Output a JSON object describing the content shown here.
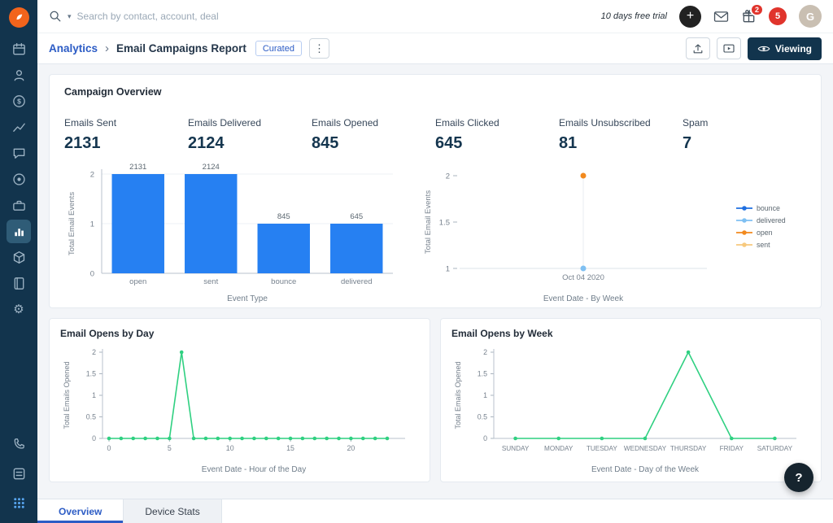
{
  "topbar": {
    "search_placeholder": "Search by contact, account, deal",
    "trial_text": "10 days free trial",
    "gift_badge_count": "2",
    "chat_badge_count": "5",
    "avatar_initial": "G"
  },
  "toolbar": {
    "breadcrumb_root": "Analytics",
    "page_title": "Email Campaigns Report",
    "curated_badge": "Curated",
    "viewing_label": "Viewing"
  },
  "glyphs": {
    "caret": "▾",
    "chevron": "›",
    "kebab": "⋮",
    "plus": "+",
    "gear": "⚙",
    "dollar": "$"
  },
  "sidebar": {
    "items": [
      "calendar",
      "contacts",
      "deals",
      "trend-chart",
      "chat",
      "target",
      "briefcase",
      "analytics",
      "cube",
      "notebook",
      "settings"
    ],
    "active_item": "analytics",
    "bottom_items": [
      "phone",
      "launcher",
      "apps-grid"
    ]
  },
  "overview": {
    "title": "Campaign Overview",
    "metrics": [
      {
        "label": "Emails Sent",
        "value": "2131"
      },
      {
        "label": "Emails Delivered",
        "value": "2124"
      },
      {
        "label": "Emails Opened",
        "value": "845"
      },
      {
        "label": "Emails Clicked",
        "value": "645"
      },
      {
        "label": "Emails Unsubscribed",
        "value": "81"
      },
      {
        "label": "Spam",
        "value": "7"
      }
    ]
  },
  "chart_data": [
    {
      "type": "bar",
      "categories": [
        "open",
        "sent",
        "bounce",
        "delivered"
      ],
      "values": [
        2131,
        2124,
        845,
        645
      ],
      "display_heights": [
        2,
        2,
        1,
        1
      ],
      "xlabel": "Event Type",
      "ylabel": "Total Email Events",
      "yticks": [
        0,
        1,
        2
      ],
      "ylim": [
        0,
        2
      ],
      "color": "#2680f2"
    },
    {
      "type": "scatter",
      "x": [
        "Oct 04 2020"
      ],
      "series": [
        {
          "name": "bounce",
          "color": "#1f6fe0",
          "values": [
            null
          ]
        },
        {
          "name": "delivered",
          "color": "#7fc0f2",
          "values": [
            1
          ]
        },
        {
          "name": "open",
          "color": "#f28a1e",
          "values": [
            2
          ]
        },
        {
          "name": "sent",
          "color": "#f7c97e",
          "values": [
            null
          ]
        }
      ],
      "xlabel": "Event Date - By Week",
      "ylabel": "Total Email Events",
      "yticks": [
        1,
        1.5,
        2
      ],
      "ylim": [
        1,
        2
      ],
      "legend_position": "right"
    },
    {
      "type": "line",
      "title": "Email Opens by Day",
      "x": [
        0,
        1,
        2,
        3,
        4,
        5,
        6,
        7,
        8,
        9,
        10,
        11,
        12,
        13,
        14,
        15,
        16,
        17,
        18,
        19,
        20,
        21,
        22,
        23
      ],
      "values": [
        0,
        0,
        0,
        0,
        0,
        0,
        2,
        0,
        0,
        0,
        0,
        0,
        0,
        0,
        0,
        0,
        0,
        0,
        0,
        0,
        0,
        0,
        0,
        0
      ],
      "xticks": [
        0,
        5,
        10,
        15,
        20
      ],
      "xlabel": "Event Date - Hour of the Day",
      "ylabel": "Total Emails Opened",
      "yticks": [
        0,
        0.5,
        1,
        1.5,
        2
      ],
      "ylim": [
        0,
        2
      ],
      "color": "#2fd081"
    },
    {
      "type": "line",
      "title": "Email Opens by Week",
      "categories": [
        "SUNDAY",
        "MONDAY",
        "TUESDAY",
        "WEDNESDAY",
        "THURSDAY",
        "FRIDAY",
        "SATURDAY"
      ],
      "values": [
        0,
        0,
        0,
        0,
        2,
        0,
        0
      ],
      "xlabel": "Event Date - Day of the Week",
      "ylabel": "Total Emails Opened",
      "yticks": [
        0,
        0.5,
        1,
        1.5,
        2
      ],
      "ylim": [
        0,
        2
      ],
      "color": "#2fd081"
    }
  ],
  "footer": {
    "tabs": [
      {
        "label": "Overview",
        "active": true
      },
      {
        "label": "Device Stats",
        "active": false
      }
    ],
    "help_label": "?"
  },
  "colors": {
    "sidebar_bg": "#12344d",
    "accent_blue": "#2c5cc5",
    "bar_blue": "#2680f2",
    "line_green": "#2fd081",
    "badge_red": "#e0342c"
  }
}
